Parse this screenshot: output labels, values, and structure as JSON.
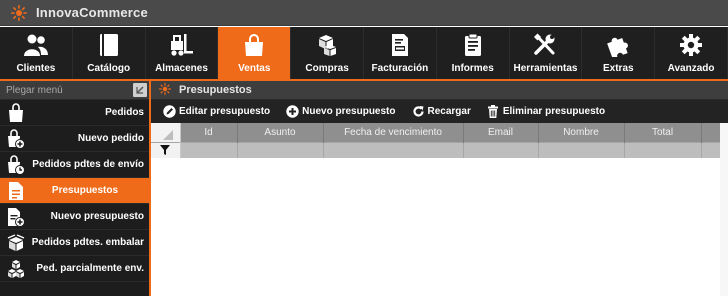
{
  "app": {
    "title": "InnovaCommerce",
    "logo_icon": "sun-logo-icon"
  },
  "colors": {
    "accent": "#ef6b1a",
    "ribbon_bg": "#1f1f1f",
    "sidebar_bg": "#1d1d1d",
    "grid_header": "#8f8f8f",
    "grid_filter_row": "#bdbdbd"
  },
  "ribbon": {
    "tabs": [
      {
        "label": "Clientes",
        "icon": "users-icon",
        "active": false
      },
      {
        "label": "Catálogo",
        "icon": "book-icon",
        "active": false
      },
      {
        "label": "Almacenes",
        "icon": "forklift-icon",
        "active": false
      },
      {
        "label": "Ventas",
        "icon": "shopping-bag-icon",
        "active": true
      },
      {
        "label": "Compras",
        "icon": "boxes-icon",
        "active": false
      },
      {
        "label": "Facturación",
        "icon": "invoice-icon",
        "active": false
      },
      {
        "label": "Informes",
        "icon": "report-icon",
        "active": false
      },
      {
        "label": "Herramientas",
        "icon": "tools-icon",
        "active": false
      },
      {
        "label": "Extras",
        "icon": "puzzle-icon",
        "active": false
      },
      {
        "label": "Avanzado",
        "icon": "gear-icon",
        "active": false
      }
    ]
  },
  "sidebar": {
    "search_placeholder": "Plegar menú",
    "items": [
      {
        "label": "Pedidos",
        "icon": "bag-icon",
        "active": false
      },
      {
        "label": "Nuevo pedido",
        "icon": "bag-plus-icon",
        "active": false
      },
      {
        "label": "Pedidos pdtes de envío",
        "icon": "bag-clock-icon",
        "active": false
      },
      {
        "label": "Presupuestos",
        "icon": "document-icon",
        "active": true
      },
      {
        "label": "Nuevo presupuesto",
        "icon": "document-plus-icon",
        "active": false
      },
      {
        "label": "Pedidos pdtes. embalar",
        "icon": "open-box-icon",
        "active": false
      },
      {
        "label": "Ped. parcialmente env.",
        "icon": "stacked-boxes-icon",
        "active": false
      }
    ]
  },
  "panel": {
    "title": "Presupuestos",
    "icon": "sun-icon",
    "toolbar": {
      "edit": "Editar presupuesto",
      "new": "Nuevo presupuesto",
      "reload": "Recargar",
      "delete": "Eliminar presupuesto"
    }
  },
  "grid": {
    "columns": [
      "Id",
      "Asunto",
      "Fecha de vencimiento",
      "Email",
      "Nombre",
      "Total"
    ],
    "rows": []
  }
}
